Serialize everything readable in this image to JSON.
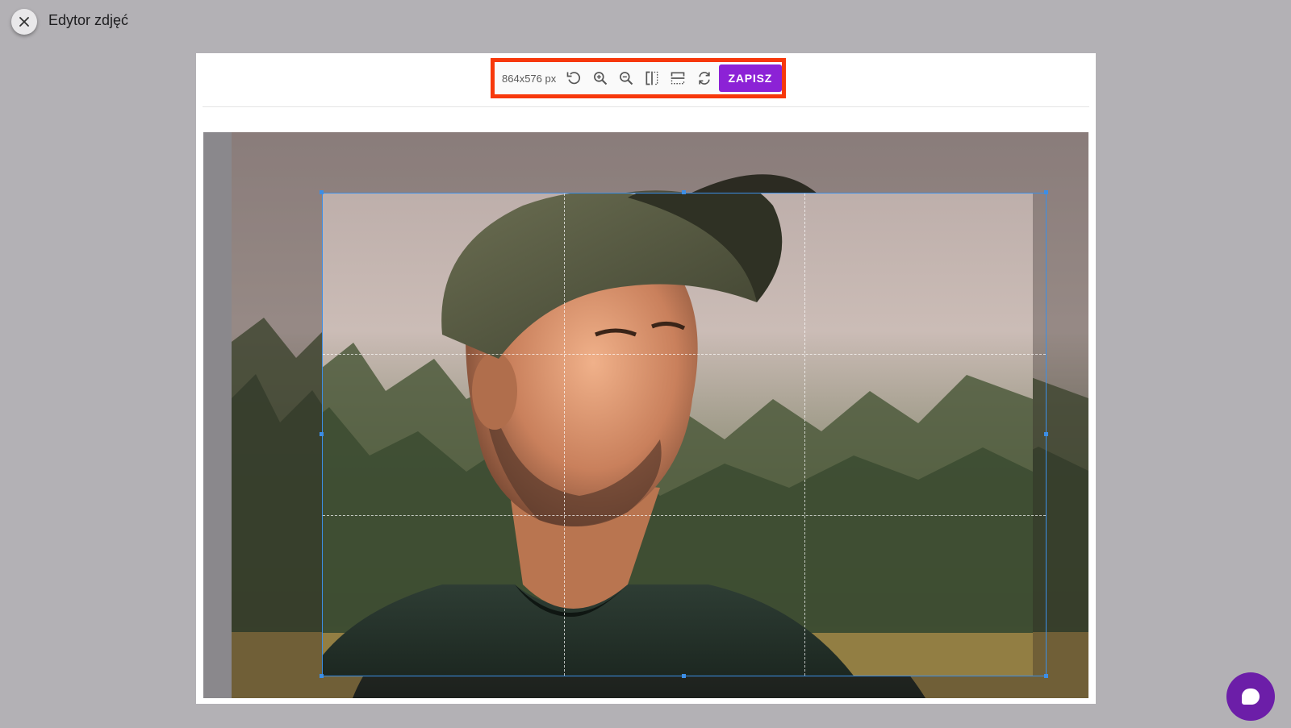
{
  "app": {
    "title": "Edytor zdjęć"
  },
  "toolbar": {
    "size_label": "864x576 px",
    "save_label": "ZAPISZ",
    "tools": [
      "rotate-left-icon",
      "zoom-in-icon",
      "zoom-out-icon",
      "flip-horizontal-icon",
      "flip-vertical-icon",
      "reset-icon"
    ]
  },
  "colors": {
    "accent": "#8c22d6",
    "highlight": "#f7380b",
    "crop_border": "#3c8ee6",
    "chat": "#6c1ea8"
  }
}
